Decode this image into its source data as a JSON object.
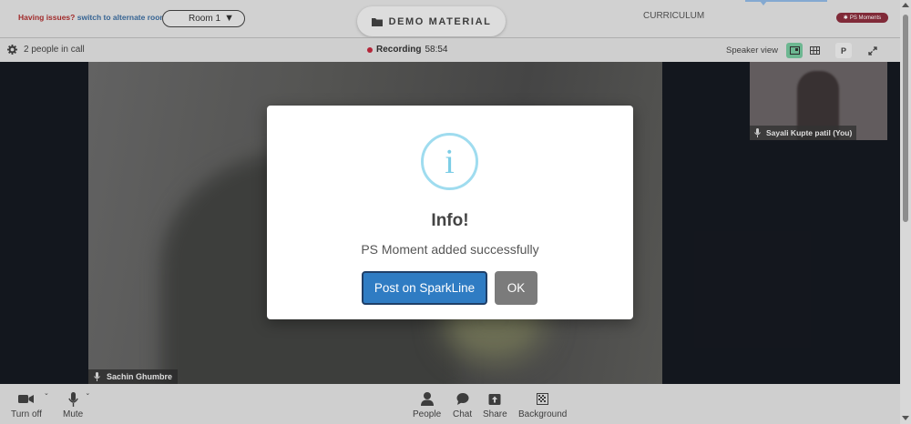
{
  "topbar": {
    "issues_text": "Having issues?",
    "switch_text": "switch to alternate room",
    "room_select": "Room 1",
    "demo_material": "DEMO MATERIAL",
    "curriculum": "CURRICULUM",
    "ps_badge": "PS Moments"
  },
  "callbar": {
    "people_count": "2 people in call",
    "recording_label": "Recording",
    "recording_time": "58:54",
    "speaker_view": "Speaker view",
    "p_button": "P"
  },
  "videos": {
    "main_name": "Sachin Ghumbre",
    "self_name": "Sayali Kupte patil (You)"
  },
  "modal": {
    "icon_glyph": "i",
    "title": "Info!",
    "message": "PS Moment added successfully",
    "primary_button": "Post on SparkLine",
    "secondary_button": "OK"
  },
  "toolbar": {
    "turn_off": "Turn off",
    "mute": "Mute",
    "people": "People",
    "chat": "Chat",
    "share": "Share",
    "background": "Background"
  },
  "colors": {
    "recording_dot": "#b01a2e",
    "primary_button": "#2f7cc3",
    "ok_button": "#7b7b7b",
    "info_icon": "#9fdcef",
    "speaker_view_active": "#66b48c"
  }
}
